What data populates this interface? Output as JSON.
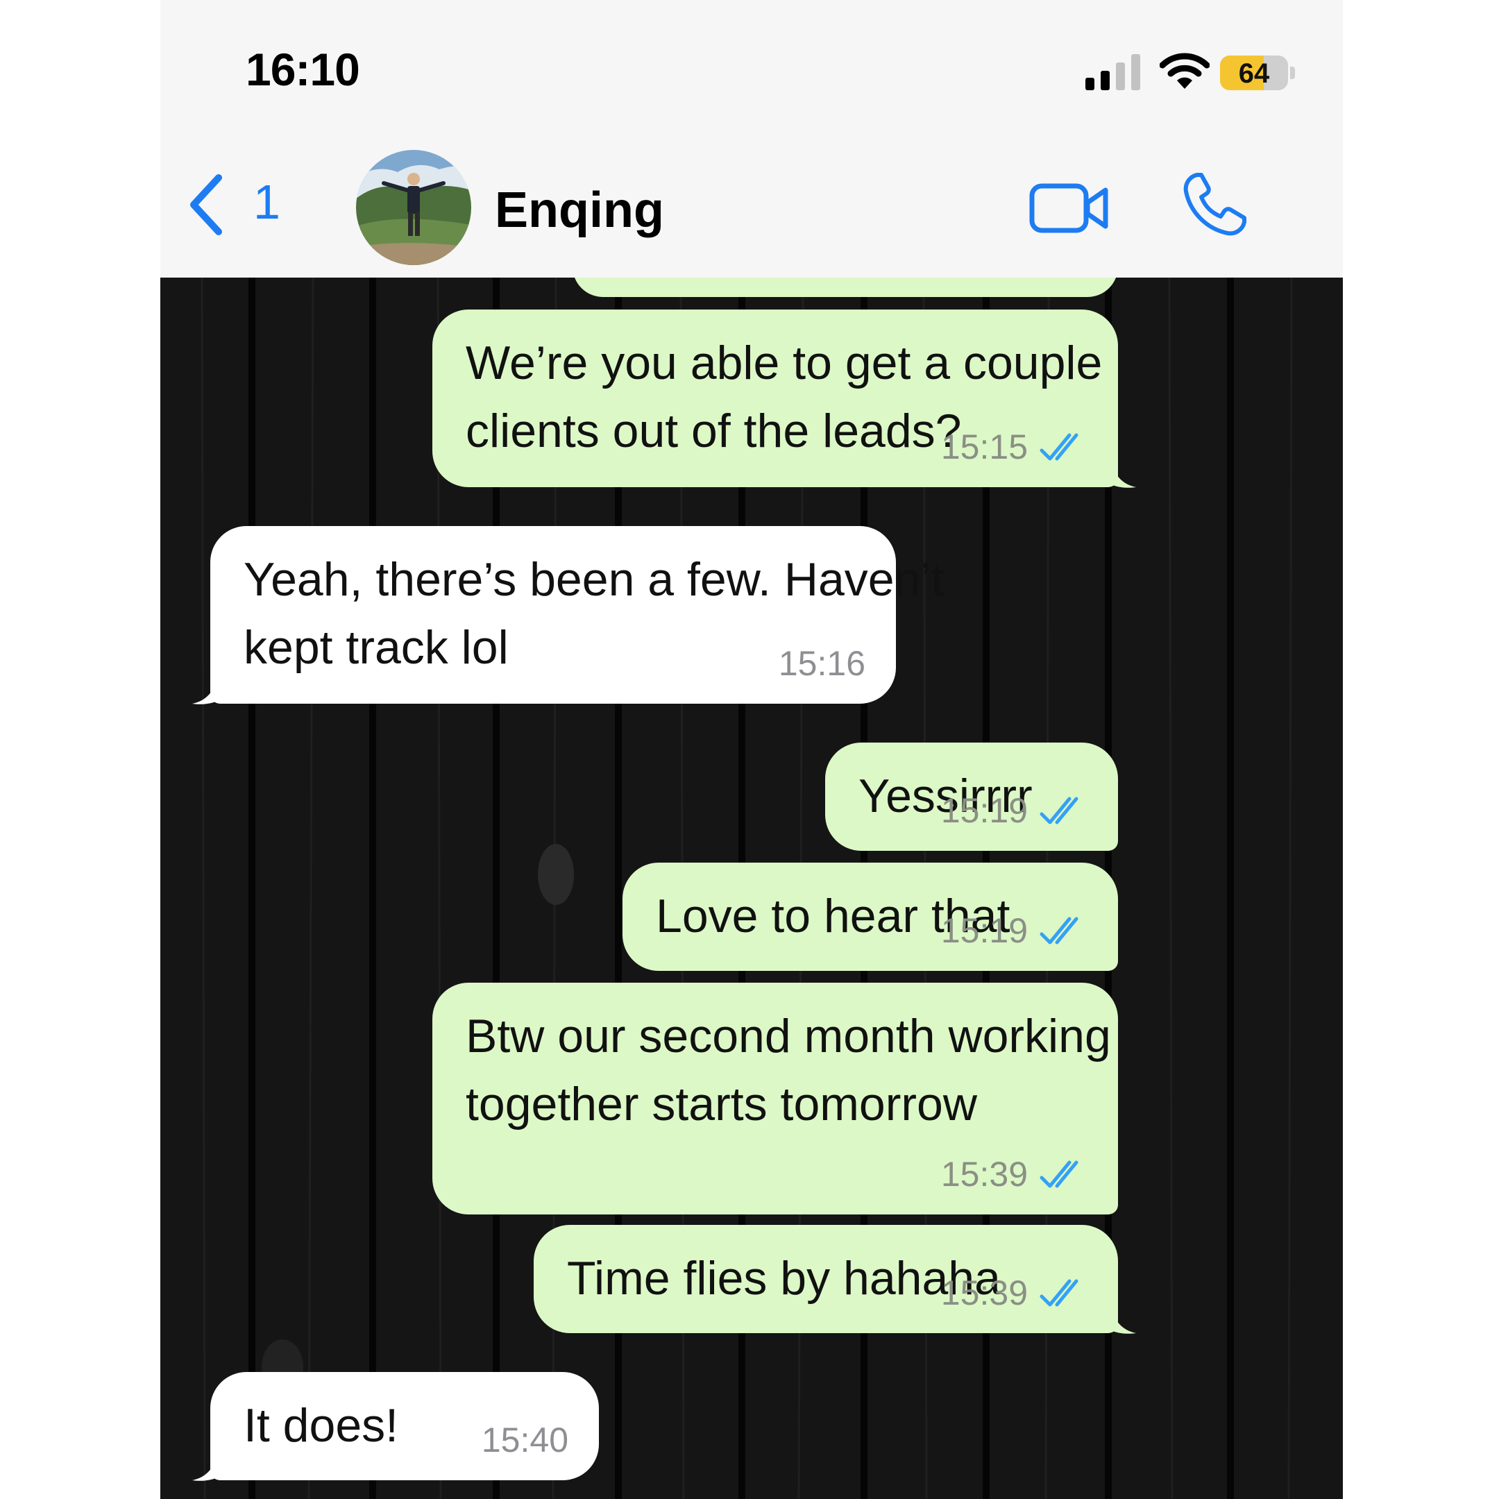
{
  "status_bar": {
    "time": "16:10",
    "battery_level": "64",
    "battery_fraction": 0.64
  },
  "header": {
    "back_count": "1",
    "contact_name": "Enqing",
    "avatar_icon": "avatar-photo",
    "accent_color": "#1d7cf2"
  },
  "messages": [
    {
      "direction": "outgoing",
      "text_lines": [
        "We’re you able to get a couple",
        "clients out of the leads?"
      ],
      "time": "15:15",
      "read": true
    },
    {
      "direction": "incoming",
      "text_lines": [
        "Yeah, there’s been a few. Haven’t",
        "kept track lol"
      ],
      "time": "15:16"
    },
    {
      "direction": "outgoing",
      "text_lines": [
        "Yessirrrr"
      ],
      "time": "15:19",
      "read": true
    },
    {
      "direction": "outgoing",
      "text_lines": [
        "Love to hear that"
      ],
      "time": "15:19",
      "read": true
    },
    {
      "direction": "outgoing",
      "text_lines": [
        "Btw our second month working",
        "together starts tomorrow"
      ],
      "time": "15:39",
      "read": true
    },
    {
      "direction": "outgoing",
      "text_lines": [
        "Time flies by hahaha"
      ],
      "time": "15:39",
      "read": true
    },
    {
      "direction": "incoming",
      "text_lines": [
        "It does!"
      ],
      "time": "15:40"
    }
  ],
  "colors": {
    "outgoing_bubble": "#dcf8c6",
    "incoming_bubble": "#ffffff",
    "read_ticks": "#34a1f5",
    "chat_background": "#121212"
  }
}
